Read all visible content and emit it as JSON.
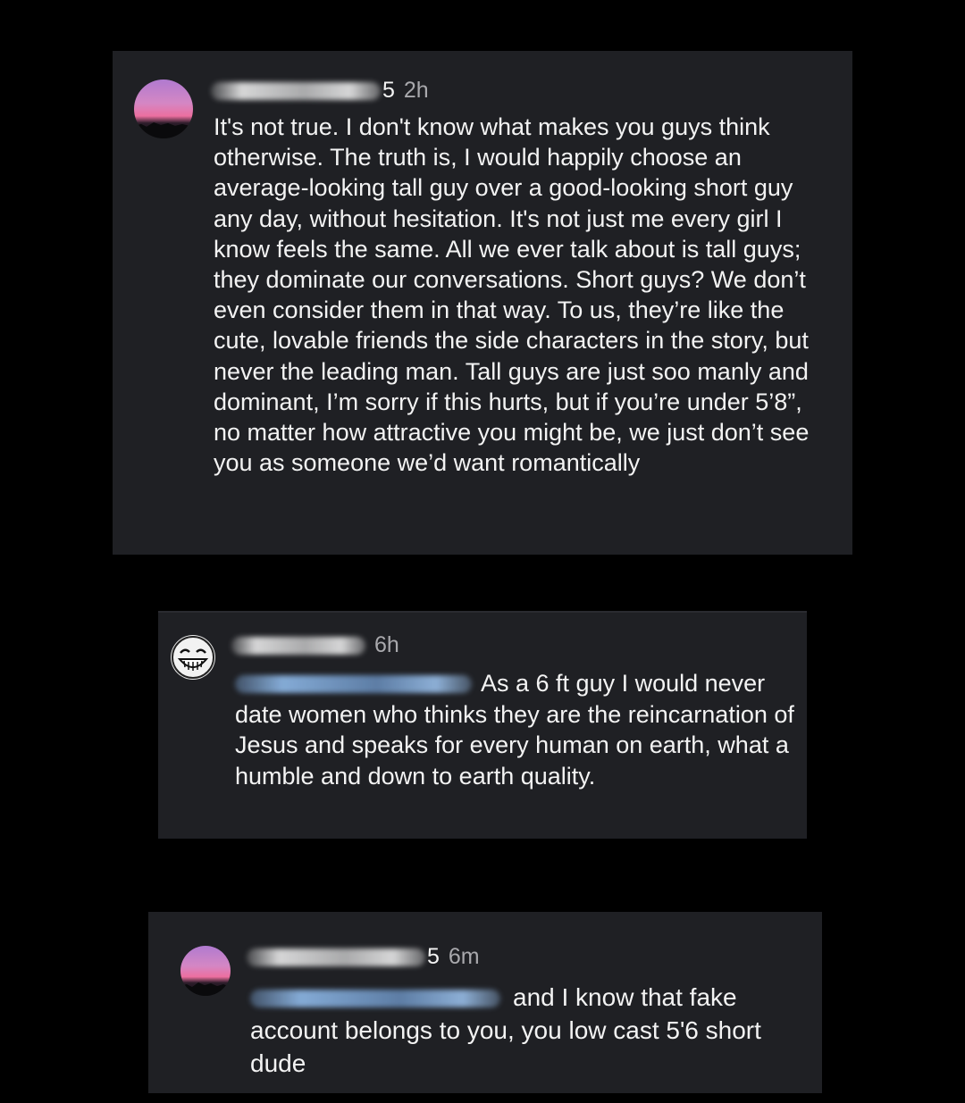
{
  "comments": [
    {
      "username_suffix": "5",
      "time": "2h",
      "avatar": "sunset-avatar",
      "mention": "",
      "text": "It's not true. I don't know what makes you guys think otherwise. The truth is, I would happily choose an average-looking tall guy over a good-looking short guy any day, without hesitation. It's not just me every girl I know feels the same. All we ever talk about is tall guys; they dominate our conversations. Short guys? We don’t even consider them in that way. To us, they’re like the cute, lovable friends the side characters in the story, but never the leading man. Tall guys are just soo manly and dominant,  I’m sorry if this hurts, but if you’re under 5’8”, no matter how attractive you might be, we just don’t see you as someone we’d want romantically"
    },
    {
      "username_suffix": "",
      "time": "6h",
      "avatar": "cartoon-grin-avatar",
      "text": "As a 6 ft guy I would never date women who thinks they are the reincarnation of Jesus and speaks for every human on earth, what a humble and down to earth quality."
    },
    {
      "username_suffix": "5",
      "time": "6m",
      "avatar": "sunset-avatar",
      "text": "and I know that fake account belongs to you, you low cast 5'6 short dude"
    }
  ],
  "colors": {
    "page_background": "#000000",
    "card_background": "#1f2024",
    "text": "#f3f3f3",
    "timestamp": "#a9a9ad",
    "mention": "#8fb8ec"
  }
}
